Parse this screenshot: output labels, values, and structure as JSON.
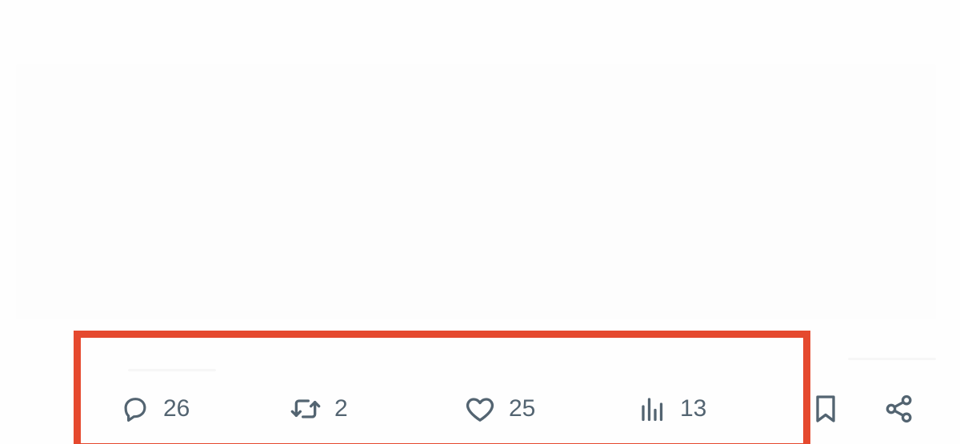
{
  "actions": {
    "reply": {
      "count": "26",
      "icon": "reply-icon"
    },
    "repost": {
      "count": "2",
      "icon": "repost-icon"
    },
    "like": {
      "count": "25",
      "icon": "heart-icon"
    },
    "views": {
      "count": "13",
      "icon": "analytics-icon"
    },
    "bookmark": {
      "icon": "bookmark-icon"
    },
    "share": {
      "icon": "share-icon"
    }
  },
  "colors": {
    "icon": "#536471",
    "highlight": "#e5492e",
    "background": "#fefefe"
  }
}
